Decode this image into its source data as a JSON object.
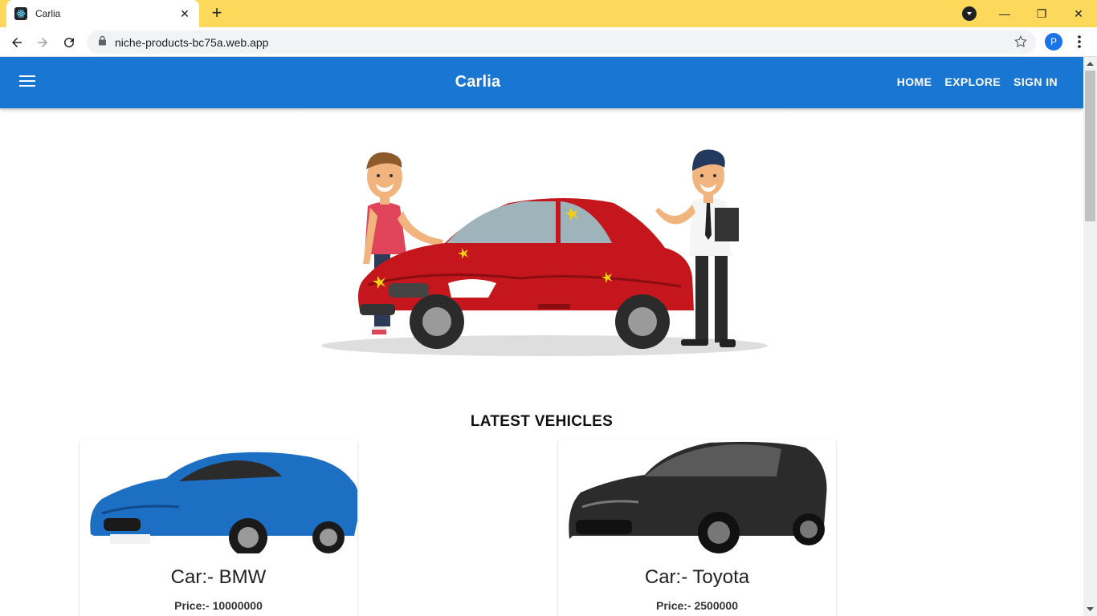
{
  "browser": {
    "tab_title": "Carlia",
    "new_tab": "+",
    "url": "niche-products-bc75a.web.app",
    "avatar_initial": "P",
    "controls": {
      "minimize": "—",
      "restore": "❐",
      "close": "✕"
    }
  },
  "appbar": {
    "brand": "Carlia",
    "nav": [
      {
        "label": "HOME"
      },
      {
        "label": "EXPLORE"
      },
      {
        "label": "SIGN IN"
      }
    ],
    "color": "#1976d2"
  },
  "section": {
    "title": "LATEST VEHICLES"
  },
  "vehicles": [
    {
      "title": "Car:- BMW",
      "price": "Price:- 10000000",
      "color": "#1d6fc4"
    },
    {
      "title": "Car:- Toyota",
      "price": "Price:- 2500000",
      "color": "#2b2b2b"
    }
  ]
}
